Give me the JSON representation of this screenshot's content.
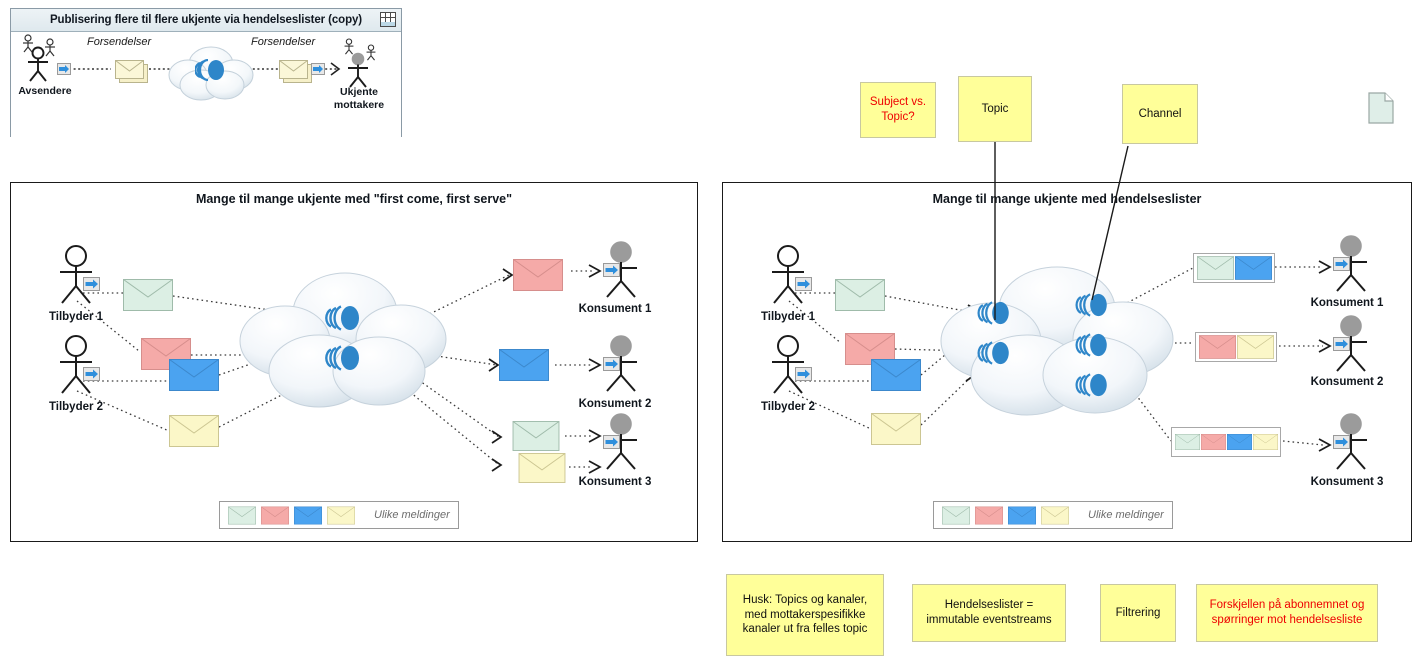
{
  "thumbnail": {
    "title": "Publisering flere til flere ukjente via hendelseslister (copy)",
    "window_icon": "layout-icon",
    "labels": {
      "senders": "Avsendere",
      "shipments_left": "Forsendelser",
      "shipments_right": "Forsendelser",
      "receivers": "Ukjente\nmottakere",
      "receivers_line1": "Ukjente",
      "receivers_line2": "mottakere"
    }
  },
  "panels": [
    {
      "id": "left",
      "title": "Mange til mange ukjente med \"first come, first serve\"",
      "providers": [
        {
          "label": "Tilbyder 1"
        },
        {
          "label": "Tilbyder 2"
        }
      ],
      "consumers": [
        {
          "label": "Konsument 1"
        },
        {
          "label": "Konsument 2"
        },
        {
          "label": "Konsument 3"
        }
      ],
      "input_messages": [
        "green",
        "red",
        "blue",
        "yellow"
      ],
      "output_messages": [
        "red",
        "blue",
        "green",
        "yellow"
      ],
      "queues": 2,
      "legend": {
        "text": "Ulike meldinger",
        "swatches": [
          "green",
          "red",
          "blue",
          "yellow"
        ]
      }
    },
    {
      "id": "right",
      "title": "Mange til mange ukjente med hendelseslister",
      "providers": [
        {
          "label": "Tilbyder 1"
        },
        {
          "label": "Tilbyder 2"
        }
      ],
      "consumers": [
        {
          "label": "Konsument 1"
        },
        {
          "label": "Konsument 2"
        },
        {
          "label": "Konsument 3"
        }
      ],
      "input_messages": [
        "green",
        "red",
        "blue",
        "yellow"
      ],
      "output_groups": [
        [
          "green",
          "blue"
        ],
        [
          "red",
          "yellow"
        ],
        [
          "green",
          "red",
          "blue",
          "yellow"
        ]
      ],
      "queues_in": 2,
      "queues_out": 3,
      "legend": {
        "text": "Ulike meldinger",
        "swatches": [
          "green",
          "red",
          "blue",
          "yellow"
        ]
      }
    }
  ],
  "notes": [
    {
      "id": "subject-vs-topic",
      "text": "Subject vs. Topic?",
      "color": "red"
    },
    {
      "id": "topic",
      "text": "Topic",
      "color": "black"
    },
    {
      "id": "channel",
      "text": "Channel",
      "color": "black"
    },
    {
      "id": "husk-topics",
      "text": "Husk: Topics og kanaler, med mottakerspesifikke kanaler ut fra felles topic",
      "color": "black"
    },
    {
      "id": "hendelseslister",
      "text": "Hendelseslister = immutable eventstreams",
      "color": "black"
    },
    {
      "id": "filtrering",
      "text": "Filtrering",
      "color": "black"
    },
    {
      "id": "forskjellen",
      "text": "Forskjellen på abonnemnet og spørringer mot hendelsesliste",
      "color": "red"
    }
  ],
  "doc_icon": {
    "name": "document-icon"
  },
  "colors": {
    "note_bg": "#FFFF99",
    "note_border": "#C8C8A0",
    "note_red_text": "#EE0000",
    "msg_green": "#D9EFE1",
    "msg_red": "#F4A9A8",
    "msg_blue": "#4BA3F0",
    "msg_yellow": "#FBF7C8",
    "queue_blue": "#2E86C9",
    "panel_border": "#1A1A1A",
    "actor_dark": "#202020",
    "actor_gray": "#9B9B9B"
  }
}
